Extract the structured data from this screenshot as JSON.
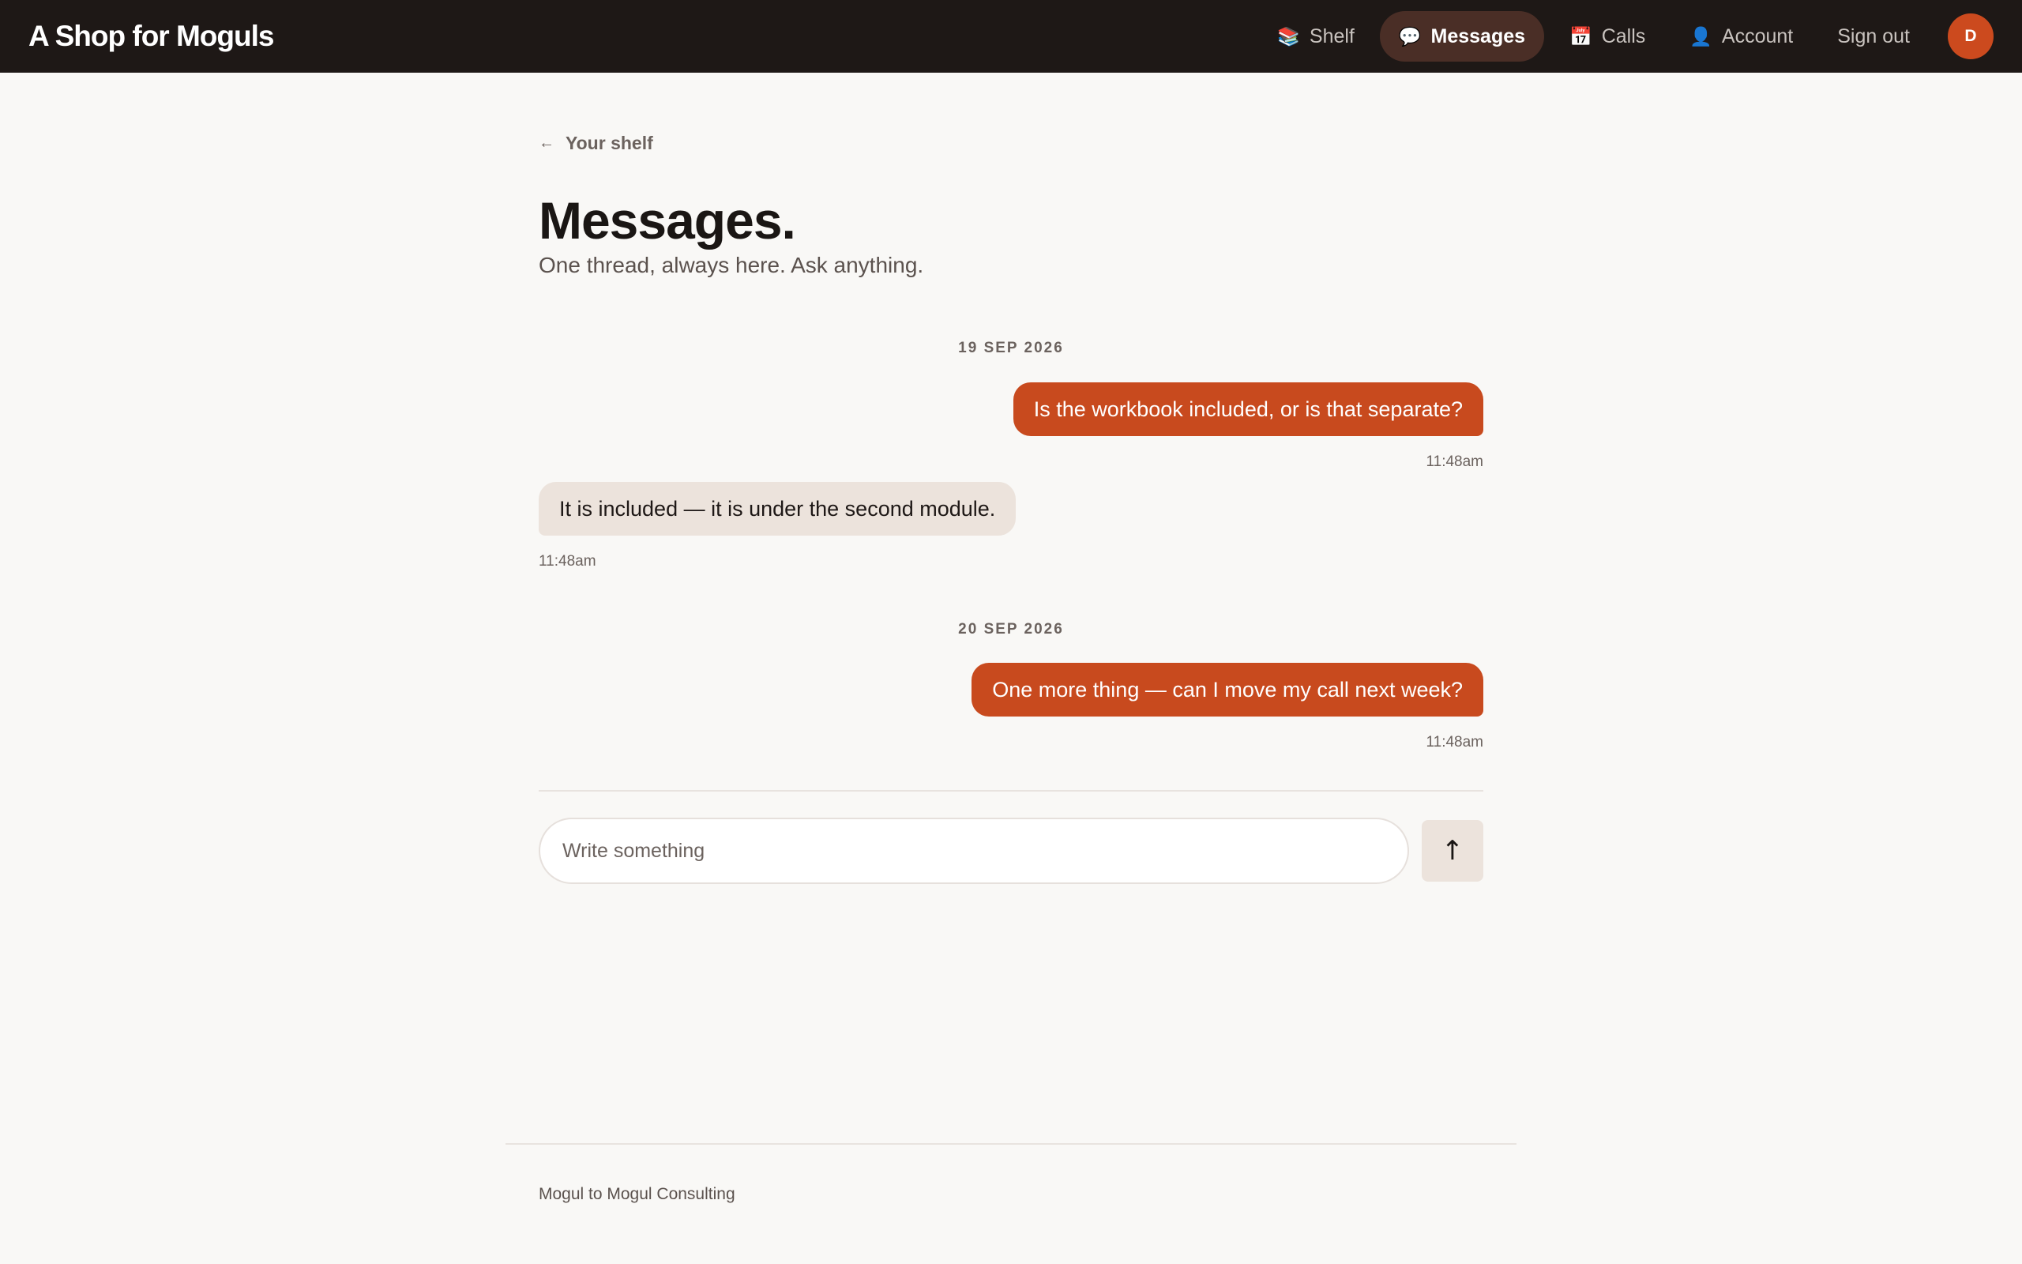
{
  "header": {
    "brand": "A Shop for Moguls",
    "nav": [
      {
        "label": "Shelf",
        "icon": "books-icon",
        "glyph": "📚",
        "active": false
      },
      {
        "label": "Messages",
        "icon": "speech-bubble-icon",
        "glyph": "💬",
        "active": true
      },
      {
        "label": "Calls",
        "icon": "calendar-icon",
        "glyph": "📅",
        "active": false
      },
      {
        "label": "Account",
        "icon": "user-icon",
        "glyph": "👤",
        "active": false
      },
      {
        "label": "Sign out",
        "icon": null,
        "glyph": "",
        "active": false
      }
    ],
    "avatar_initial": "D"
  },
  "page": {
    "back_label": "Your shelf",
    "back_arrow": "←",
    "title": "Messages.",
    "subtitle": "One thread, always here. Ask anything."
  },
  "thread": [
    {
      "date": "19 SEP 2026",
      "messages": [
        {
          "direction": "out",
          "text": "Is the workbook included, or is that separate?",
          "time": "11:48am"
        },
        {
          "direction": "in",
          "text": "It is included — it is under the second module.",
          "time": "11:48am"
        }
      ]
    },
    {
      "date": "20 SEP 2026",
      "messages": [
        {
          "direction": "out",
          "text": "One more thing — can I move my call next week?",
          "time": "11:48am"
        }
      ]
    }
  ],
  "composer": {
    "placeholder": "Write something",
    "value": "",
    "send_glyph": "↑"
  },
  "footer": {
    "text": "Mogul to Mogul Consulting"
  },
  "colors": {
    "header_bg": "#1e1816",
    "accent": "#c84a1e",
    "incoming_bubble": "#ece3dc",
    "page_bg": "#f9f8f6"
  }
}
